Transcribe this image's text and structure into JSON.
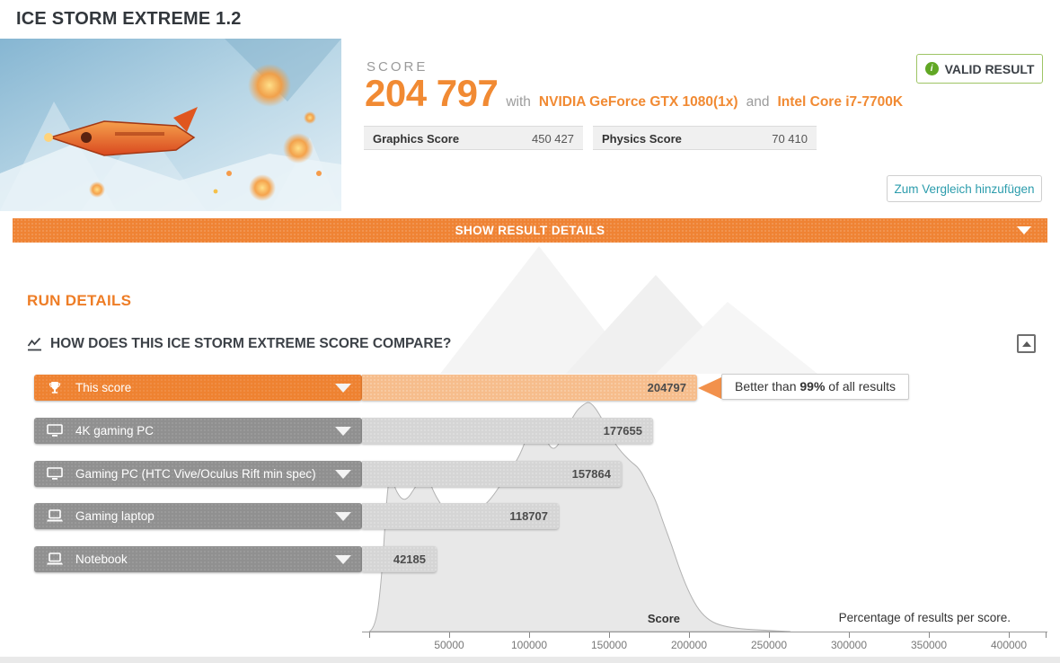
{
  "page": {
    "title": "ICE STORM EXTREME 1.2",
    "accent_orange": "#ef8334",
    "accent_green": "#61a724",
    "accent_teal": "#2b9cac"
  },
  "result": {
    "score_label": "SCORE",
    "score_value": "204 797",
    "with_text": "with",
    "gpu_name": "NVIDIA GeForce GTX 1080(1x)",
    "and_text": "and",
    "cpu_name": "Intel Core i7-7700K",
    "valid_badge": "VALID RESULT",
    "info_icon_glyph": "i",
    "compare_button": "Zum Vergleich hinzufügen",
    "subscores": [
      {
        "label": "Graphics Score",
        "value": "450 427"
      },
      {
        "label": "Physics Score",
        "value": "70 410"
      }
    ],
    "show_details": "SHOW RESULT DETAILS"
  },
  "run_details": {
    "section_title": "RUN DETAILS",
    "compare_title": "HOW DOES THIS ICE STORM EXTREME SCORE COMPARE?"
  },
  "chart_data": {
    "type": "bar",
    "title": "HOW DOES THIS ICE STORM EXTREME SCORE COMPARE?",
    "xlabel": "Score",
    "right_note": "Percentage of results per score.",
    "xlim": [
      0,
      400000
    ],
    "x_ticks": [
      50000,
      100000,
      150000,
      200000,
      250000,
      300000,
      350000,
      400000
    ],
    "legend_position": "left-labels",
    "grid": false,
    "bars": [
      {
        "label": "This score",
        "value": 204797,
        "highlight": true,
        "icon": "trophy-icon"
      },
      {
        "label": "4K gaming PC",
        "value": 177655,
        "highlight": false,
        "icon": "desktop-icon"
      },
      {
        "label": "Gaming PC (HTC Vive/Oculus Rift min spec)",
        "value": 157864,
        "highlight": false,
        "icon": "desktop-icon"
      },
      {
        "label": "Gaming laptop",
        "value": 118707,
        "highlight": false,
        "icon": "laptop-icon"
      },
      {
        "label": "Notebook",
        "value": 42185,
        "highlight": false,
        "icon": "laptop-icon"
      }
    ],
    "callout": {
      "prefix": "Better than ",
      "bold": "99%",
      "suffix": " of all results"
    },
    "distribution": [
      [
        0,
        0
      ],
      [
        4000,
        0.01
      ],
      [
        8000,
        0.21
      ],
      [
        10700,
        0.48
      ],
      [
        12900,
        0.6
      ],
      [
        16300,
        0.53
      ],
      [
        20800,
        0.49
      ],
      [
        24700,
        0.5
      ],
      [
        28700,
        0.54
      ],
      [
        33100,
        0.57
      ],
      [
        36500,
        0.58
      ],
      [
        41000,
        0.51
      ],
      [
        47800,
        0.45
      ],
      [
        56700,
        0.43
      ],
      [
        65700,
        0.44
      ],
      [
        75800,
        0.49
      ],
      [
        85400,
        0.58
      ],
      [
        93800,
        0.65
      ],
      [
        100600,
        0.76
      ],
      [
        104500,
        0.78
      ],
      [
        109000,
        0.74
      ],
      [
        114600,
        0.67
      ],
      [
        120800,
        0.72
      ],
      [
        128700,
        0.82
      ],
      [
        134300,
        0.85
      ],
      [
        138200,
        0.86
      ],
      [
        144400,
        0.81
      ],
      [
        153400,
        0.7
      ],
      [
        162400,
        0.64
      ],
      [
        169100,
        0.61
      ],
      [
        174700,
        0.54
      ],
      [
        179200,
        0.49
      ],
      [
        183700,
        0.41
      ],
      [
        189300,
        0.32
      ],
      [
        194900,
        0.22
      ],
      [
        200500,
        0.14
      ],
      [
        206100,
        0.08
      ],
      [
        212900,
        0.04
      ],
      [
        221300,
        0.02
      ],
      [
        232500,
        0.01
      ],
      [
        246600,
        0.005
      ],
      [
        263400,
        0
      ]
    ]
  }
}
